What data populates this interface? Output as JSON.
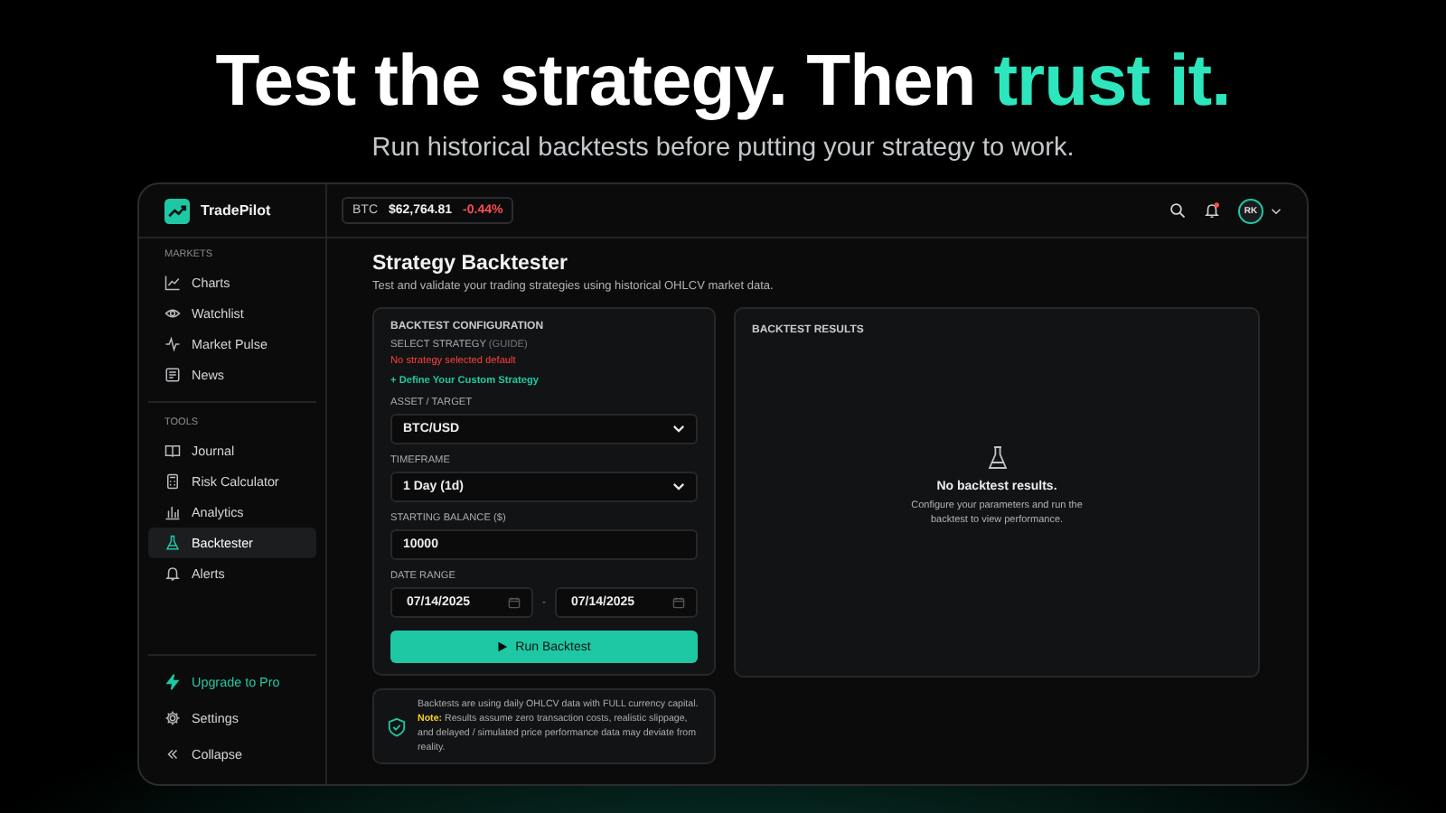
{
  "headline": {
    "main": "Test the strategy. Then",
    "accent": "trust it.",
    "subtitle": "Run historical backtests before putting your strategy to work."
  },
  "app": {
    "name": "TradePilot",
    "ticker": {
      "symbol": "BTC",
      "price": "$62,764.81",
      "change": "-0.44%"
    },
    "user": {
      "initials": "RK",
      "notification": true
    },
    "sidebar": {
      "sections": [
        {
          "title": "MARKETS",
          "items": [
            {
              "label": "Charts",
              "selected": false
            },
            {
              "label": "Watchlist",
              "selected": false
            },
            {
              "label": "Market Pulse",
              "selected": false
            },
            {
              "label": "News",
              "selected": false
            }
          ]
        },
        {
          "title": "TOOLS",
          "items": [
            {
              "label": "Journal",
              "selected": false
            },
            {
              "label": "Risk Calculator",
              "selected": false
            },
            {
              "label": "Analytics",
              "selected": false
            },
            {
              "label": "Backtester",
              "selected": true
            },
            {
              "label": "Alerts",
              "selected": false
            }
          ]
        }
      ],
      "footer": [
        {
          "label": "Upgrade to Pro",
          "kind": "upgrade"
        },
        {
          "label": "Settings",
          "kind": "plain"
        },
        {
          "label": "Collapse",
          "kind": "plain"
        }
      ]
    },
    "page": {
      "title": "Strategy Backtester",
      "subtitle": "Test and validate your trading strategies using historical OHLCV market data.",
      "config": {
        "heading": "BACKTEST CONFIGURATION",
        "strategy_label": "SELECT STRATEGY",
        "strategy_hint": "(GUIDE)",
        "strategy_error": "No strategy selected default",
        "define_link": "+ Define Your Custom Strategy",
        "asset": {
          "label": "ASSET / TARGET",
          "value": "BTC/USD"
        },
        "timeframe": {
          "label": "TIMEFRAME",
          "value": "1 Day (1d)"
        },
        "balance": {
          "label": "STARTING BALANCE ($)",
          "value": "10000"
        },
        "dates": {
          "label": "DATE RANGE",
          "start": "07/14/2025",
          "separator": "-",
          "end": "07/14/2025"
        },
        "run_button": "Run Backtest"
      },
      "note": "Backtests are using daily OHLCV data with FULL currency capital. **Note:** Results assume zero transaction costs, realistic slippage, and delayed / simulated price performance data may deviate from reality.",
      "results": {
        "heading": "BACKTEST RESULTS",
        "empty_title": "No backtest results.",
        "empty_text": "Configure your parameters and run the backtest to view performance."
      }
    }
  }
}
